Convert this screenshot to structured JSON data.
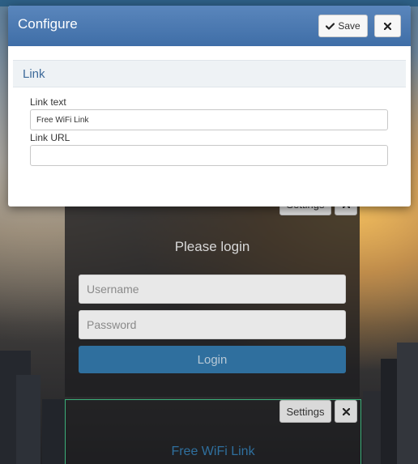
{
  "modal": {
    "title": "Configure",
    "save_label": "Save",
    "section_title": "Link",
    "fields": {
      "link_text_label": "Link text",
      "link_text_value": "Free WiFi Link",
      "link_url_label": "Link URL",
      "link_url_value": ""
    }
  },
  "login": {
    "settings_label": "Settings",
    "heading": "Please login",
    "username_placeholder": "Username",
    "password_placeholder": "Password",
    "button_label": "Login"
  },
  "wifi": {
    "settings_label": "Settings",
    "link_text": "Free WiFi Link"
  },
  "colors": {
    "header": "#4a79b2",
    "accent": "#2f6f9e",
    "wifi_border": "#3bb07a"
  },
  "icons": {
    "save": "check-icon",
    "close": "close-icon"
  }
}
